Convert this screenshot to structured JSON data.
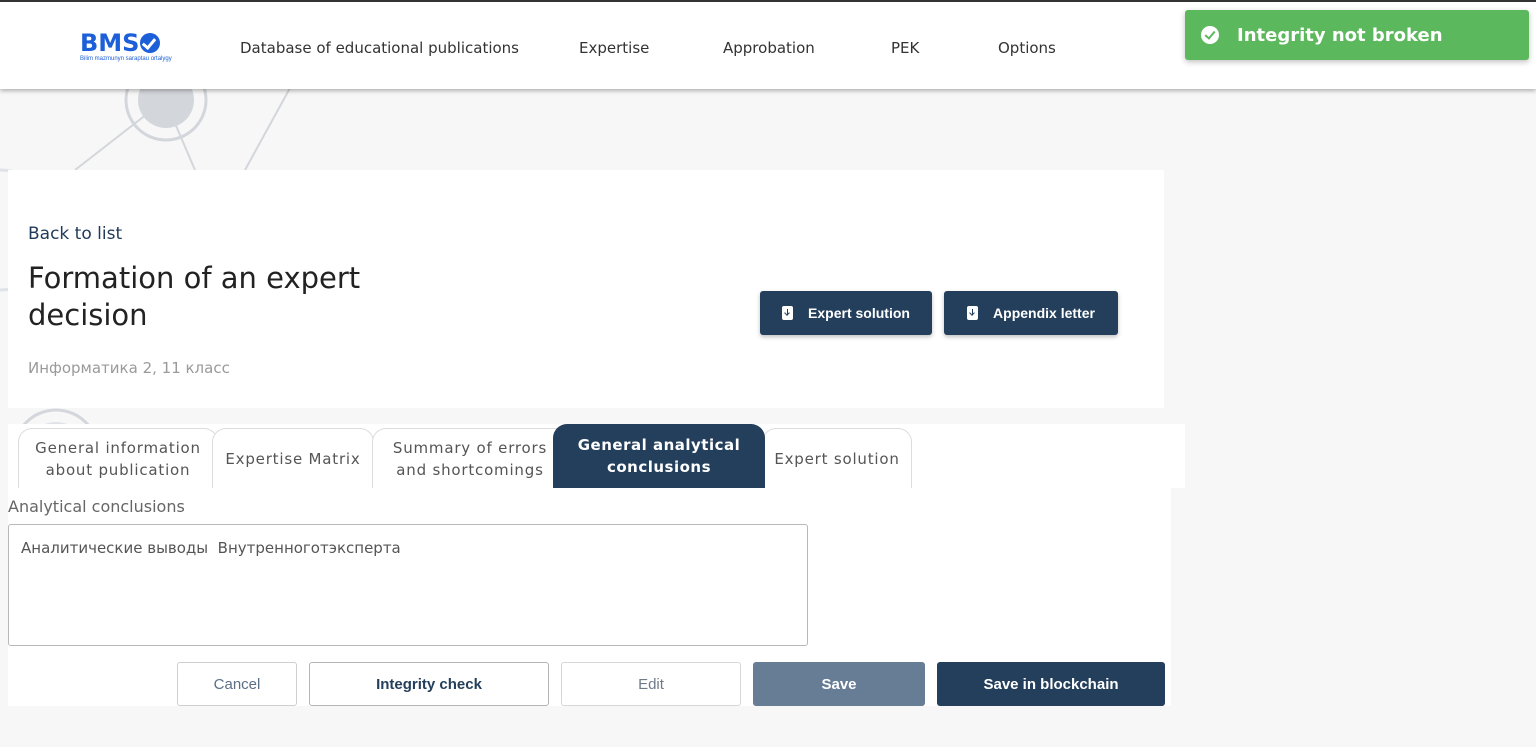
{
  "header": {
    "logo_text": "BMS",
    "logo_subtitle": "Bilim mazmunyn saraptau ortalygy",
    "nav": [
      {
        "label": "Database of educational publications"
      },
      {
        "label": "Expertise"
      },
      {
        "label": "Approbation"
      },
      {
        "label": "PEK"
      },
      {
        "label": "Options"
      }
    ]
  },
  "toast": {
    "message": "Integrity not broken",
    "icon": "check-circle-icon",
    "color": "#5cb85c"
  },
  "card": {
    "back_link": "Back to list",
    "title": "Formation of an expert decision",
    "subtitle": "Информатика 2, 11 класс",
    "buttons": {
      "expert_solution": "Expert solution",
      "appendix_letter": "Appendix letter"
    }
  },
  "tabs": [
    {
      "label": "General information about publication",
      "active": false
    },
    {
      "label": "Expertise Matrix",
      "active": false
    },
    {
      "label": "Summary of errors and shortcomings",
      "active": false
    },
    {
      "label": "General analytical conclusions",
      "active": true
    },
    {
      "label": "Expert solution",
      "active": false
    }
  ],
  "content": {
    "section_label": "Analytical conclusions",
    "textarea_value": "Аналитические выводы  Внутренноготэксперта"
  },
  "actions": {
    "cancel": "Cancel",
    "integrity_check": "Integrity check",
    "edit": "Edit",
    "save": "Save",
    "save_blockchain": "Save in blockchain"
  },
  "colors": {
    "primary": "#243f5c",
    "primary_dim": "#677d95",
    "logo": "#1c5fd8"
  }
}
